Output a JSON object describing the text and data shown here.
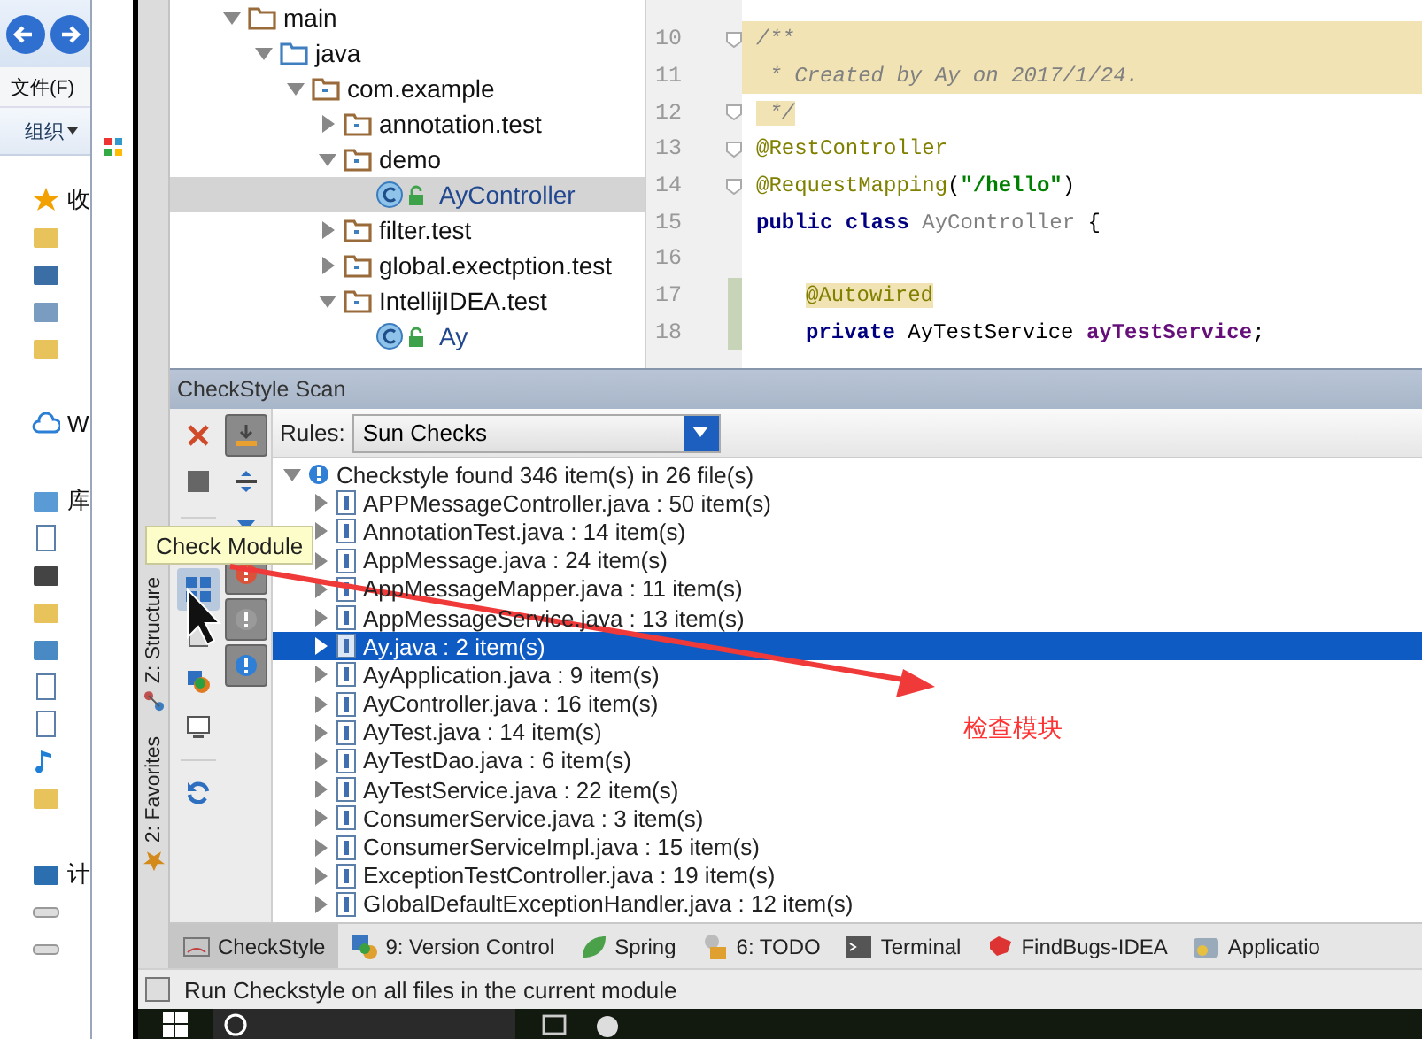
{
  "explorer": {
    "menu": "文件(F)",
    "organize": "组织",
    "nav_groups": [
      {
        "items": [
          {
            "label": "收",
            "kind": "star"
          },
          {
            "kind": "download"
          },
          {
            "kind": "desktop"
          },
          {
            "kind": "recent"
          },
          {
            "kind": "folder"
          }
        ]
      },
      {
        "items": [
          {
            "label": "W",
            "kind": "cloud"
          }
        ]
      },
      {
        "items": [
          {
            "label": "库",
            "kind": "library"
          },
          {
            "kind": "document"
          },
          {
            "kind": "video"
          },
          {
            "kind": "folder"
          },
          {
            "kind": "picture"
          },
          {
            "kind": "document"
          },
          {
            "kind": "document"
          },
          {
            "kind": "music"
          },
          {
            "kind": "folder"
          }
        ]
      },
      {
        "items": [
          {
            "label": "计",
            "kind": "computer"
          },
          {
            "kind": "drive"
          },
          {
            "kind": "drive"
          }
        ]
      }
    ]
  },
  "project_tree": [
    {
      "label": "main",
      "kind": "folder",
      "expanded": true,
      "selected": false,
      "children": [
        {
          "label": "java",
          "kind": "source",
          "expanded": true,
          "selected": false,
          "children": [
            {
              "label": "com.example",
              "kind": "package",
              "expanded": true,
              "selected": false,
              "children": [
                {
                  "label": "annotation.test",
                  "kind": "package",
                  "expanded": false,
                  "selected": false
                },
                {
                  "label": "demo",
                  "kind": "package",
                  "expanded": true,
                  "selected": false,
                  "children": [
                    {
                      "label": "AyController",
                      "kind": "class",
                      "selected": true
                    }
                  ]
                },
                {
                  "label": "filter.test",
                  "kind": "package",
                  "expanded": false,
                  "selected": false
                },
                {
                  "label": "global.exectption.test",
                  "kind": "package",
                  "expanded": false,
                  "selected": false
                },
                {
                  "label": "IntellijIDEA.test",
                  "kind": "package",
                  "expanded": true,
                  "selected": false,
                  "children": [
                    {
                      "label": "Ay",
                      "kind": "class",
                      "selected": false
                    }
                  ]
                }
              ]
            }
          ]
        }
      ]
    }
  ],
  "editor": {
    "lines": [
      {
        "number": "10",
        "highlighted": true,
        "fold": true,
        "changed": false,
        "segments": [
          {
            "kind": "comment",
            "text": "/**"
          }
        ]
      },
      {
        "number": "11",
        "highlighted": true,
        "fold": false,
        "changed": false,
        "segments": [
          {
            "kind": "comment",
            "text": " * Created by Ay on 2017/1/24."
          }
        ]
      },
      {
        "number": "12",
        "highlighted": false,
        "fold": true,
        "changed": false,
        "segments": [
          {
            "kind": "comment",
            "text": " */"
          }
        ]
      },
      {
        "number": "13",
        "highlighted": false,
        "fold": true,
        "changed": false,
        "segments": [
          {
            "kind": "annotation",
            "text": "@RestController"
          }
        ]
      },
      {
        "number": "14",
        "highlighted": false,
        "fold": true,
        "changed": false,
        "segments": [
          {
            "kind": "annotation",
            "text": "@RequestMapping"
          },
          {
            "kind": "plain",
            "text": "("
          },
          {
            "kind": "string",
            "text": "\"/hello\""
          },
          {
            "kind": "plain",
            "text": ")"
          }
        ]
      },
      {
        "number": "15",
        "highlighted": false,
        "fold": false,
        "changed": false,
        "segments": [
          {
            "kind": "keyword",
            "text": "public class "
          },
          {
            "kind": "unused",
            "text": "AyController"
          },
          {
            "kind": "plain",
            "text": " {"
          }
        ]
      },
      {
        "number": "16",
        "highlighted": false,
        "fold": false,
        "changed": false
      },
      {
        "number": "17",
        "highlighted": false,
        "fold": false,
        "changed": true,
        "indented": true,
        "segments": [
          {
            "kind": "marked",
            "text": "@Autowired"
          }
        ]
      },
      {
        "number": "18",
        "highlighted": false,
        "fold": false,
        "changed": true,
        "indented": true,
        "segments": [
          {
            "kind": "keyword",
            "text": "private"
          },
          {
            "kind": "plain",
            "text": " AyTestService "
          },
          {
            "kind": "field",
            "text": "ayTestService"
          },
          {
            "kind": "plain",
            "text": ";"
          }
        ]
      }
    ]
  },
  "scan": {
    "title": "CheckStyle Scan",
    "rules_label": "Rules:",
    "rules_value": "Sun Checks",
    "results": {
      "label": "Checkstyle found 346 item(s) in 26 file(s)",
      "expanded": true,
      "children": [
        {
          "label": "APPMessageController.java : 50 item(s)",
          "selected": false
        },
        {
          "label": "AnnotationTest.java : 14 item(s)",
          "selected": false
        },
        {
          "label": "AppMessage.java : 24 item(s)",
          "selected": false
        },
        {
          "label": "AppMessageMapper.java : 11 item(s)",
          "selected": false
        },
        {
          "label": "AppMessageService.java : 13 item(s)",
          "selected": false
        },
        {
          "label": "Ay.java : 2 item(s)",
          "selected": true
        },
        {
          "label": "AyApplication.java : 9 item(s)",
          "selected": false
        },
        {
          "label": "AyController.java : 16 item(s)",
          "selected": false
        },
        {
          "label": "AyTest.java : 14 item(s)",
          "selected": false
        },
        {
          "label": "AyTestDao.java : 6 item(s)",
          "selected": false
        },
        {
          "label": "AyTestService.java : 22 item(s)",
          "selected": false
        },
        {
          "label": "ConsumerService.java : 3 item(s)",
          "selected": false
        },
        {
          "label": "ConsumerServiceImpl.java : 15 item(s)",
          "selected": false
        },
        {
          "label": "ExceptionTestController.java : 19 item(s)",
          "selected": false
        },
        {
          "label": "GlobalDefaultExceptionHandler.java : 12 item(s)",
          "selected": false
        }
      ]
    },
    "tooltip": "Check Module"
  },
  "side_tabs": [
    {
      "label": "Z: Structure",
      "kind": "structure"
    },
    {
      "label": "2: Favorites",
      "kind": "favorites"
    }
  ],
  "bottom_tabs": [
    {
      "label": "CheckStyle",
      "kind": "checkstyle",
      "selected": true
    },
    {
      "label": "9: Version Control",
      "kind": "vcs",
      "selected": false
    },
    {
      "label": "Spring",
      "kind": "spring",
      "selected": false
    },
    {
      "label": "6: TODO",
      "kind": "todo",
      "selected": false
    },
    {
      "label": "Terminal",
      "kind": "terminal",
      "selected": false
    },
    {
      "label": "FindBugs-IDEA",
      "kind": "findbugs",
      "selected": false
    },
    {
      "label": "Applicatio",
      "kind": "application",
      "selected": false
    }
  ],
  "status_bar": "Run Checkstyle on all files in the current module",
  "annotation": "检查模块"
}
